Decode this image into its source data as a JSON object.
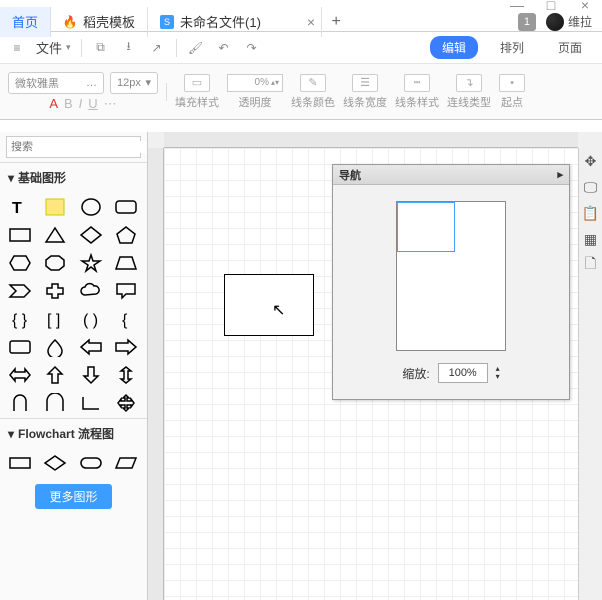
{
  "window": {
    "minimize": "—",
    "maximize": "□",
    "close": "×"
  },
  "tabs": {
    "home": "首页",
    "template": {
      "icon": "🔥",
      "label": "稻壳模板"
    },
    "doc": {
      "icon": "📄",
      "label": "未命名文件(1)",
      "close": "×"
    },
    "add": "+",
    "counter": "1",
    "username": "维拉"
  },
  "toolbar1": {
    "menu": "≡",
    "file": "文件",
    "caret": "▾",
    "modes": {
      "edit": "编辑",
      "arrange": "排列",
      "page": "页面"
    }
  },
  "toolbar2": {
    "font": "微软雅黑",
    "font_caret": "…",
    "size": "12px",
    "size_caret": "▾",
    "bold": "A",
    "b": "B",
    "i": "I",
    "u": "U",
    "more": "⋯",
    "fill": "填充样式",
    "opacity_val": "0%",
    "opacity": "透明度",
    "line_color": "线条颜色",
    "line_width": "线条宽度",
    "line_style": "线条样式",
    "connector": "连线类型",
    "start": "起点"
  },
  "sidebar": {
    "search_placeholder": "搜索",
    "cat_basic": "基础图形",
    "cat_flow": "Flowchart 流程图",
    "more": "更多图形"
  },
  "nav": {
    "title": "导航",
    "collapse": "▸",
    "zoom_label": "缩放:",
    "zoom_value": "100%"
  },
  "right_tools": [
    "✥",
    "🖵",
    "📋",
    "▦",
    "🗋"
  ]
}
